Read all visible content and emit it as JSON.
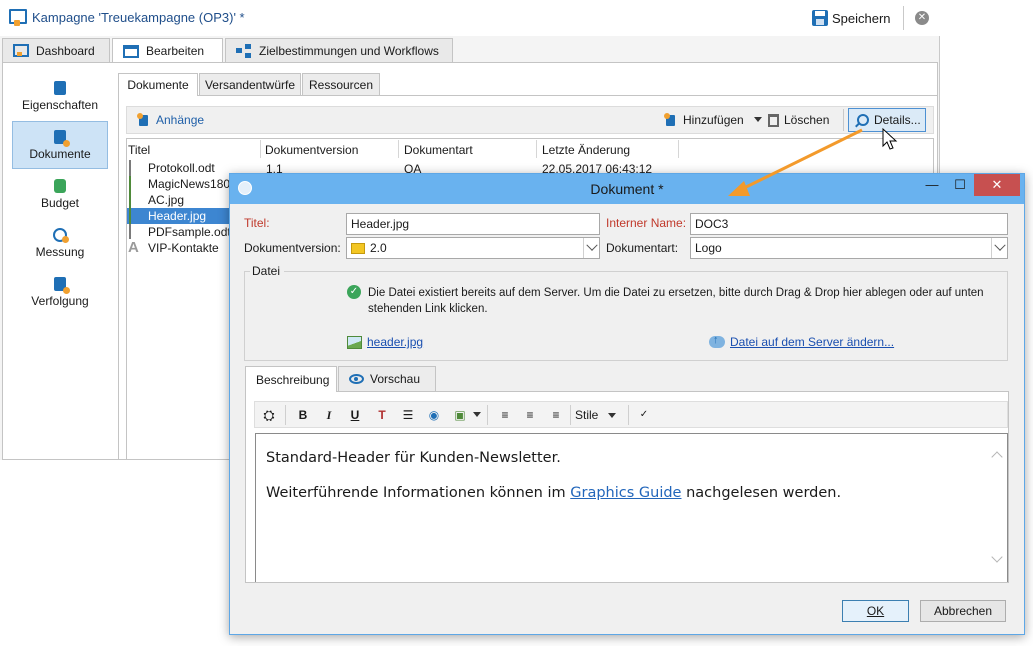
{
  "window": {
    "title": "Kampagne 'Treuekampagne (OP3)' *",
    "save_label": "Speichern"
  },
  "main_tabs": [
    {
      "label": "Dashboard"
    },
    {
      "label": "Bearbeiten"
    },
    {
      "label": "Zielbestimmungen und Workflows"
    }
  ],
  "sidebar": {
    "items": [
      {
        "label": "Eigenschaften"
      },
      {
        "label": "Dokumente"
      },
      {
        "label": "Budget"
      },
      {
        "label": "Messung"
      },
      {
        "label": "Verfolgung"
      }
    ]
  },
  "sub_tabs": [
    {
      "label": "Dokumente"
    },
    {
      "label": "Versandentwürfe"
    },
    {
      "label": "Ressourcen"
    }
  ],
  "toolbar": {
    "attachments_label": "Anhänge",
    "add_label": "Hinzufügen",
    "delete_label": "Löschen",
    "details_label": "Details..."
  },
  "table": {
    "columns": [
      "Titel",
      "Dokumentversion",
      "Dokumentart",
      "Letzte Änderung"
    ],
    "rows": [
      {
        "title": "Protokoll.odt",
        "version": "1.1",
        "type": "QA",
        "modified": "22.05.2017 06:43:12"
      },
      {
        "title": "MagicNews180"
      },
      {
        "title": "AC.jpg"
      },
      {
        "title": "Header.jpg"
      },
      {
        "title": "PDFsample.odt"
      },
      {
        "title": "VIP-Kontakte"
      }
    ]
  },
  "dialog": {
    "title": "Dokument *",
    "titel_label": "Titel:",
    "titel_value": "Header.jpg",
    "intern_label": "Interner Name:",
    "intern_value": "DOC3",
    "version_label": "Dokumentversion:",
    "version_value": "2.0",
    "art_label": "Dokumentart:",
    "art_value": "Logo",
    "datei_label": "Datei",
    "datei_info": "Die Datei existiert bereits auf dem Server. Um die Datei zu ersetzen, bitte durch Drag & Drop hier ablegen oder auf unten stehenden Link klicken.",
    "file_link": "header.jpg",
    "change_link": "Datei auf dem Server ändern...",
    "tab_beschreibung": "Beschreibung",
    "tab_vorschau": "Vorschau",
    "style_label": "Stile",
    "editor_line1": "Standard-Header für Kunden-Newsletter.",
    "editor_line2_pre": "Weiterführende Informationen können im ",
    "editor_line2_link": "Graphics Guide",
    "editor_line2_post": " nachgelesen werden.",
    "ok_label": "OK",
    "cancel_label": "Abbrechen"
  },
  "colors": {
    "accent": "#1f6fb5",
    "arrow": "#f39a2b",
    "dialog_title": "#69b2ef",
    "selection": "#3d86d1"
  }
}
